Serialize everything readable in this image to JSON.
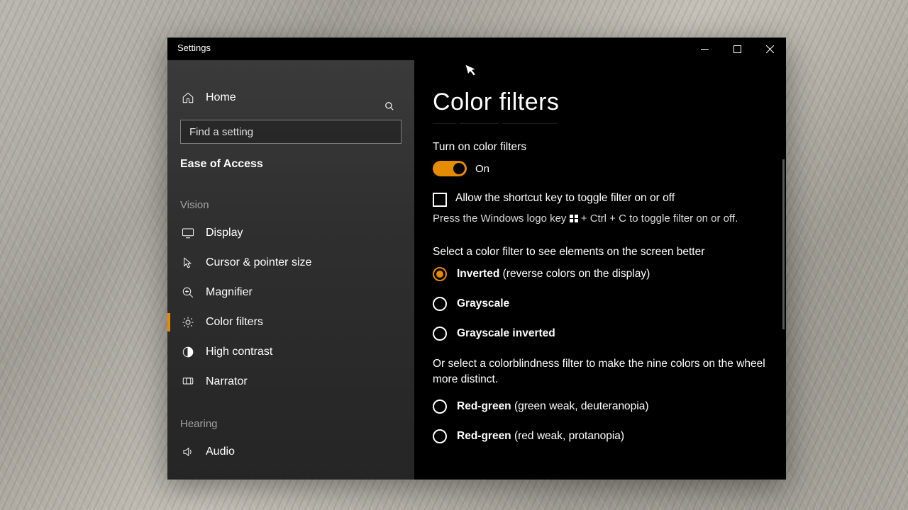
{
  "window_title": "Settings",
  "sidebar": {
    "home_label": "Home",
    "search_placeholder": "Find a setting",
    "category_label": "Ease of Access",
    "groups": [
      {
        "label": "Vision",
        "items": [
          {
            "id": "display",
            "label": "Display"
          },
          {
            "id": "cursor",
            "label": "Cursor & pointer size"
          },
          {
            "id": "magnifier",
            "label": "Magnifier"
          },
          {
            "id": "colorfilters",
            "label": "Color filters",
            "active": true
          },
          {
            "id": "highcontrast",
            "label": "High contrast"
          },
          {
            "id": "narrator",
            "label": "Narrator"
          }
        ]
      },
      {
        "label": "Hearing",
        "items": [
          {
            "id": "audio",
            "label": "Audio"
          }
        ]
      }
    ]
  },
  "main": {
    "title": "Color filters",
    "toggle_section_label": "Turn on color filters",
    "toggle_state_label": "On",
    "toggle_on": true,
    "shortcut_checkbox_label": "Allow the shortcut key to toggle filter on or off",
    "shortcut_checked": false,
    "shortcut_hint_prefix": "Press the Windows logo key ",
    "shortcut_hint_suffix": " + Ctrl + C to toggle filter on or off.",
    "filter_section_label": "Select a color filter to see elements on the screen better",
    "filter_options": [
      {
        "id": "inverted",
        "bold": "Inverted",
        "rest": " (reverse colors on the display)",
        "selected": true
      },
      {
        "id": "grayscale",
        "bold": "Grayscale",
        "rest": "",
        "selected": false
      },
      {
        "id": "grayscale-inverted",
        "bold": "Grayscale inverted",
        "rest": "",
        "selected": false
      }
    ],
    "colorblind_intro": "Or select a colorblindness filter to make the nine colors on the wheel more distinct.",
    "colorblind_options": [
      {
        "id": "deuteranopia",
        "bold": "Red-green",
        "rest": " (green weak, deuteranopia)",
        "selected": false
      },
      {
        "id": "protanopia",
        "bold": "Red-green",
        "rest": " (red weak, protanopia)",
        "selected": false
      }
    ]
  },
  "colors": {
    "accent": "#e68a00"
  }
}
